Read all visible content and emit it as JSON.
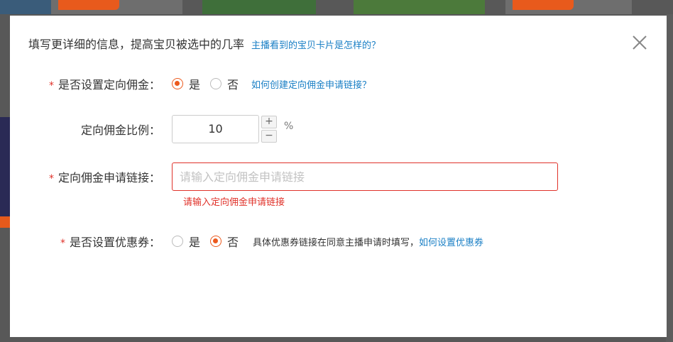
{
  "modal": {
    "title": "填写更详细的信息，提高宝贝被选中的几率",
    "help_link": "主播看到的宝贝卡片是怎样的？"
  },
  "form": {
    "commission": {
      "required_mark": "*",
      "label": "是否设置定向佣金：",
      "options": [
        "是",
        "否"
      ],
      "selected": "是",
      "help_link": "如何创建定向佣金申请链接？"
    },
    "ratio": {
      "label": "定向佣金比例：",
      "value": "10",
      "plus": "+",
      "minus": "−",
      "unit": "%"
    },
    "link": {
      "required_mark": "*",
      "label": "定向佣金申请链接：",
      "placeholder": "请输入定向佣金申请链接",
      "value": "",
      "error": "请输入定向佣金申请链接"
    },
    "coupon": {
      "required_mark": "*",
      "label": "是否设置优惠券：",
      "options": [
        "是",
        "否"
      ],
      "selected": "否",
      "hint": "具体优惠券链接在同意主播申请时填写，",
      "help_link": "如何设置优惠券"
    }
  },
  "colors": {
    "accent": "#ec5a1e",
    "link": "#1a7fc5",
    "error": "#e0322a"
  }
}
